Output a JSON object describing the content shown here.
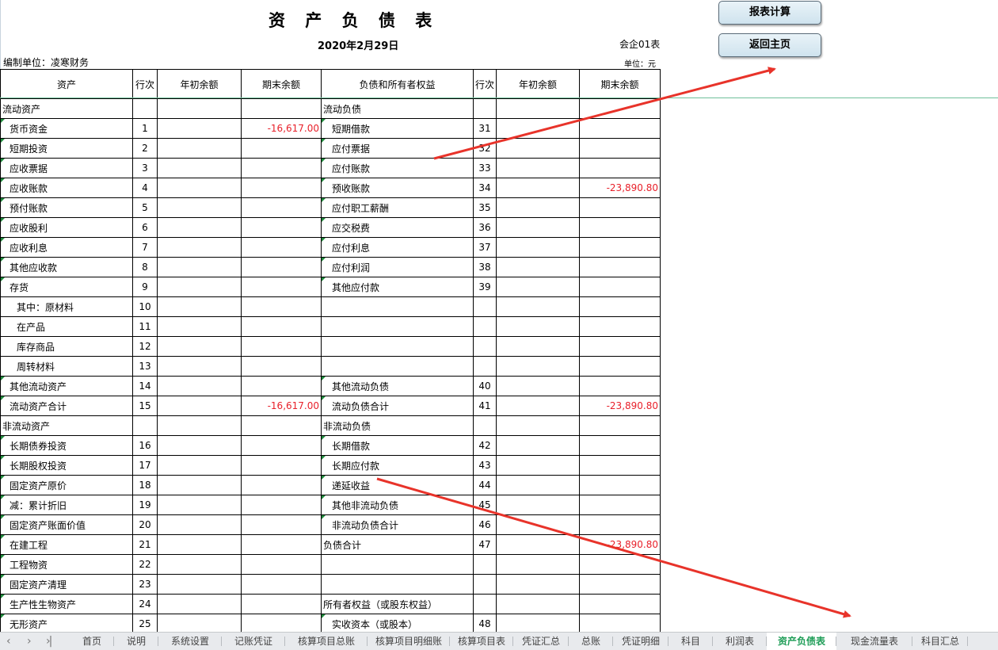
{
  "report": {
    "title": "资 产 负 债 表",
    "date": "2020年2月29日",
    "form_no": "会企01表",
    "unit_name": "编制单位：凌寒财务",
    "unit": "单位：元"
  },
  "buttons": {
    "calc": "报表计算",
    "home": "返回主页"
  },
  "headers": [
    "资产",
    "行次",
    "年初余额",
    "期末余额",
    "负债和所有者权益",
    "行次",
    "年初余额",
    "期末余额"
  ],
  "rows": [
    {
      "a": "流动资产",
      "an": "",
      "ab": "",
      "ae": "",
      "l": "流动负债",
      "ln": "",
      "lb": "",
      "le": "",
      "ai": 0,
      "li": 0,
      "at": false,
      "lt": false
    },
    {
      "a": "货币资金",
      "an": "1",
      "ab": "",
      "ae": "-16,617.00",
      "l": "短期借款",
      "ln": "31",
      "lb": "",
      "le": "",
      "ai": 1,
      "li": 1,
      "at": true,
      "lt": true
    },
    {
      "a": "短期投资",
      "an": "2",
      "ab": "",
      "ae": "",
      "l": "应付票据",
      "ln": "32",
      "lb": "",
      "le": "",
      "ai": 1,
      "li": 1,
      "at": true,
      "lt": true
    },
    {
      "a": "应收票据",
      "an": "3",
      "ab": "",
      "ae": "",
      "l": "应付账款",
      "ln": "33",
      "lb": "",
      "le": "",
      "ai": 1,
      "li": 1,
      "at": true,
      "lt": true
    },
    {
      "a": "应收账款",
      "an": "4",
      "ab": "",
      "ae": "",
      "l": "预收账款",
      "ln": "34",
      "lb": "",
      "le": "-23,890.80",
      "ai": 1,
      "li": 1,
      "at": true,
      "lt": true
    },
    {
      "a": "预付账款",
      "an": "5",
      "ab": "",
      "ae": "",
      "l": "应付职工薪酬",
      "ln": "35",
      "lb": "",
      "le": "",
      "ai": 1,
      "li": 1,
      "at": true,
      "lt": true
    },
    {
      "a": "应收股利",
      "an": "6",
      "ab": "",
      "ae": "",
      "l": "应交税费",
      "ln": "36",
      "lb": "",
      "le": "",
      "ai": 1,
      "li": 1,
      "at": true,
      "lt": true
    },
    {
      "a": "应收利息",
      "an": "7",
      "ab": "",
      "ae": "",
      "l": "应付利息",
      "ln": "37",
      "lb": "",
      "le": "",
      "ai": 1,
      "li": 1,
      "at": true,
      "lt": true
    },
    {
      "a": "其他应收款",
      "an": "8",
      "ab": "",
      "ae": "",
      "l": "应付利润",
      "ln": "38",
      "lb": "",
      "le": "",
      "ai": 1,
      "li": 1,
      "at": true,
      "lt": true
    },
    {
      "a": "存货",
      "an": "9",
      "ab": "",
      "ae": "",
      "l": "其他应付款",
      "ln": "39",
      "lb": "",
      "le": "",
      "ai": 1,
      "li": 1,
      "at": true,
      "lt": true
    },
    {
      "a": "其中：原材料",
      "an": "10",
      "ab": "",
      "ae": "",
      "l": "",
      "ln": "",
      "lb": "",
      "le": "",
      "ai": 2,
      "li": 0,
      "at": false,
      "lt": false
    },
    {
      "a": "在产品",
      "an": "11",
      "ab": "",
      "ae": "",
      "l": "",
      "ln": "",
      "lb": "",
      "le": "",
      "ai": 2,
      "li": 0,
      "at": false,
      "lt": false
    },
    {
      "a": "库存商品",
      "an": "12",
      "ab": "",
      "ae": "",
      "l": "",
      "ln": "",
      "lb": "",
      "le": "",
      "ai": 2,
      "li": 0,
      "at": false,
      "lt": false
    },
    {
      "a": "周转材料",
      "an": "13",
      "ab": "",
      "ae": "",
      "l": "",
      "ln": "",
      "lb": "",
      "le": "",
      "ai": 2,
      "li": 0,
      "at": false,
      "lt": false
    },
    {
      "a": "其他流动资产",
      "an": "14",
      "ab": "",
      "ae": "",
      "l": "其他流动负债",
      "ln": "40",
      "lb": "",
      "le": "",
      "ai": 1,
      "li": 1,
      "at": true,
      "lt": true
    },
    {
      "a": "流动资产合计",
      "an": "15",
      "ab": "",
      "ae": "-16,617.00",
      "l": "流动负债合计",
      "ln": "41",
      "lb": "",
      "le": "-23,890.80",
      "ai": 1,
      "li": 1,
      "at": true,
      "lt": true
    },
    {
      "a": "非流动资产",
      "an": "",
      "ab": "",
      "ae": "",
      "l": "非流动负债",
      "ln": "",
      "lb": "",
      "le": "",
      "ai": 0,
      "li": 0,
      "at": false,
      "lt": false
    },
    {
      "a": "长期债券投资",
      "an": "16",
      "ab": "",
      "ae": "",
      "l": "长期借款",
      "ln": "42",
      "lb": "",
      "le": "",
      "ai": 1,
      "li": 1,
      "at": true,
      "lt": true
    },
    {
      "a": "长期股权投资",
      "an": "17",
      "ab": "",
      "ae": "",
      "l": "长期应付款",
      "ln": "43",
      "lb": "",
      "le": "",
      "ai": 1,
      "li": 1,
      "at": true,
      "lt": true
    },
    {
      "a": "固定资产原价",
      "an": "18",
      "ab": "",
      "ae": "",
      "l": "递延收益",
      "ln": "44",
      "lb": "",
      "le": "",
      "ai": 1,
      "li": 1,
      "at": true,
      "lt": true
    },
    {
      "a": "减：累计折旧",
      "an": "19",
      "ab": "",
      "ae": "",
      "l": "其他非流动负债",
      "ln": "45",
      "lb": "",
      "le": "",
      "ai": 1,
      "li": 1,
      "at": true,
      "lt": true
    },
    {
      "a": "固定资产账面价值",
      "an": "20",
      "ab": "",
      "ae": "",
      "l": "非流动负债合计",
      "ln": "46",
      "lb": "",
      "le": "",
      "ai": 1,
      "li": 1,
      "at": true,
      "lt": true
    },
    {
      "a": "在建工程",
      "an": "21",
      "ab": "",
      "ae": "",
      "l": "负债合计",
      "ln": "47",
      "lb": "",
      "le": "-23,890.80",
      "ai": 1,
      "li": 0,
      "at": true,
      "lt": false
    },
    {
      "a": "工程物资",
      "an": "22",
      "ab": "",
      "ae": "",
      "l": "",
      "ln": "",
      "lb": "",
      "le": "",
      "ai": 1,
      "li": 0,
      "at": true,
      "lt": false
    },
    {
      "a": "固定资产清理",
      "an": "23",
      "ab": "",
      "ae": "",
      "l": "",
      "ln": "",
      "lb": "",
      "le": "",
      "ai": 1,
      "li": 0,
      "at": true,
      "lt": false
    },
    {
      "a": "生产性生物资产",
      "an": "24",
      "ab": "",
      "ae": "",
      "l": "所有者权益（或股东权益）",
      "ln": "",
      "lb": "",
      "le": "",
      "ai": 1,
      "li": 0,
      "at": true,
      "lt": false
    },
    {
      "a": "无形资产",
      "an": "25",
      "ab": "",
      "ae": "",
      "l": "实收资本（或股本）",
      "ln": "48",
      "lb": "",
      "le": "",
      "ai": 1,
      "li": 1,
      "at": true,
      "lt": true
    }
  ],
  "tabs": [
    "首页",
    "说明",
    "系统设置",
    "记账凭证",
    "核算项目总账",
    "核算项目明细账",
    "核算项目表",
    "凭证汇总",
    "总账",
    "凭证明细",
    "科目",
    "利润表",
    "资产负债表",
    "现金流量表",
    "科目汇总"
  ],
  "active_tab": "资产负债表",
  "nav_icons": [
    "first-sheet-icon",
    "prev-sheet-icon",
    "next-sheet-icon",
    "last-sheet-icon"
  ],
  "colors": {
    "negative": "#e8202a",
    "active_tab": "#1e9d57",
    "annotation_arrow": "#e8332a",
    "cell_marker": "#1f8a3c"
  }
}
